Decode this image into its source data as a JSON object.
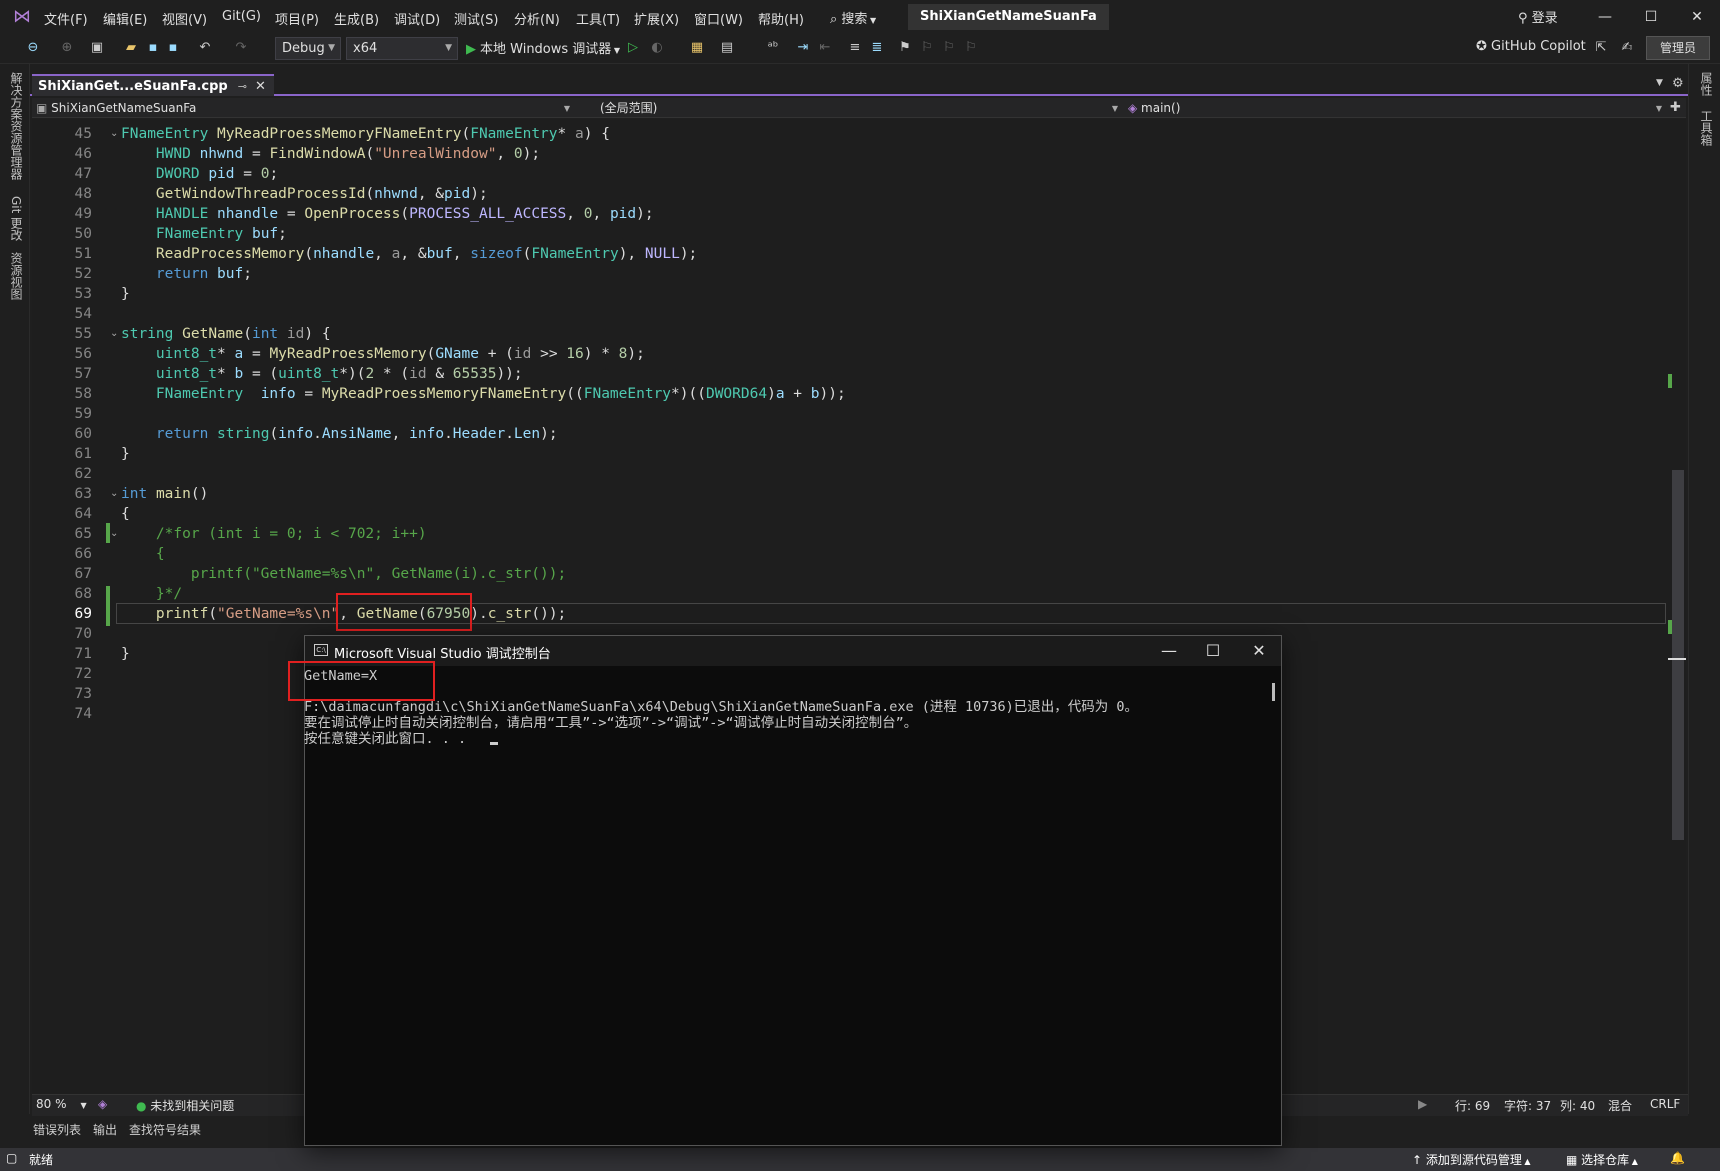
{
  "titlebar": {
    "menus": [
      "文件(F)",
      "编辑(E)",
      "视图(V)",
      "Git(G)",
      "项目(P)",
      "生成(B)",
      "调试(D)",
      "测试(S)",
      "分析(N)",
      "工具(T)",
      "扩展(X)",
      "窗口(W)",
      "帮助(H)"
    ],
    "search_label": "搜索",
    "solution_name": "ShiXianGetNameSuanFa",
    "login_label": "登录"
  },
  "toolbar": {
    "config": "Debug",
    "platform": "x64",
    "run_label": "本地 Windows 调试器",
    "copilot_label": "GitHub Copilot",
    "admin_label": "管理员"
  },
  "left_panels": [
    "解决方案资源管理器",
    "Git 更改",
    "资源视图"
  ],
  "right_panels": [
    "属性",
    "工具箱"
  ],
  "document_tab": {
    "label": "ShiXianGet...eSuanFa.cpp"
  },
  "navbar": {
    "project": "ShiXianGetNameSuanFa",
    "scope": "(全局范围)",
    "member": "main()"
  },
  "editor": {
    "line_numbers": [
      "45",
      "46",
      "47",
      "48",
      "49",
      "50",
      "51",
      "52",
      "53",
      "54",
      "55",
      "56",
      "57",
      "58",
      "59",
      "60",
      "61",
      "62",
      "63",
      "64",
      "65",
      "66",
      "67",
      "68",
      "69",
      "70",
      "71",
      "72",
      "73",
      "74"
    ],
    "current_line": "69"
  },
  "editor_status": {
    "zoom": "80 %",
    "issues": "未找到相关问题",
    "row": "行: 69",
    "char": "字符: 37",
    "col": "列: 40",
    "indent": "混合",
    "eol": "CRLF"
  },
  "bottom_tabs": [
    "错误列表",
    "输出",
    "查找符号结果"
  ],
  "statusbar": {
    "ready": "就绪",
    "add_source": "添加到源代码管理",
    "select_repo": "选择仓库"
  },
  "console": {
    "title": "Microsoft Visual Studio 调试控制台",
    "output_line": "GetName=X",
    "exit_line": "F:\\daimacunfangdi\\c\\ShiXianGetNameSuanFa\\x64\\Debug\\ShiXianGetNameSuanFa.exe (进程 10736)已退出，代码为 0。",
    "hint_line": "要在调试停止时自动关闭控制台，请启用“工具”->“选项”->“调试”->“调试停止时自动关闭控制台”。",
    "press_line": "按任意键关闭此窗口. . ."
  },
  "colors": {
    "accent": "#8a65c9",
    "highlight_box": "#e02020",
    "change_bar": "#57a64a"
  }
}
